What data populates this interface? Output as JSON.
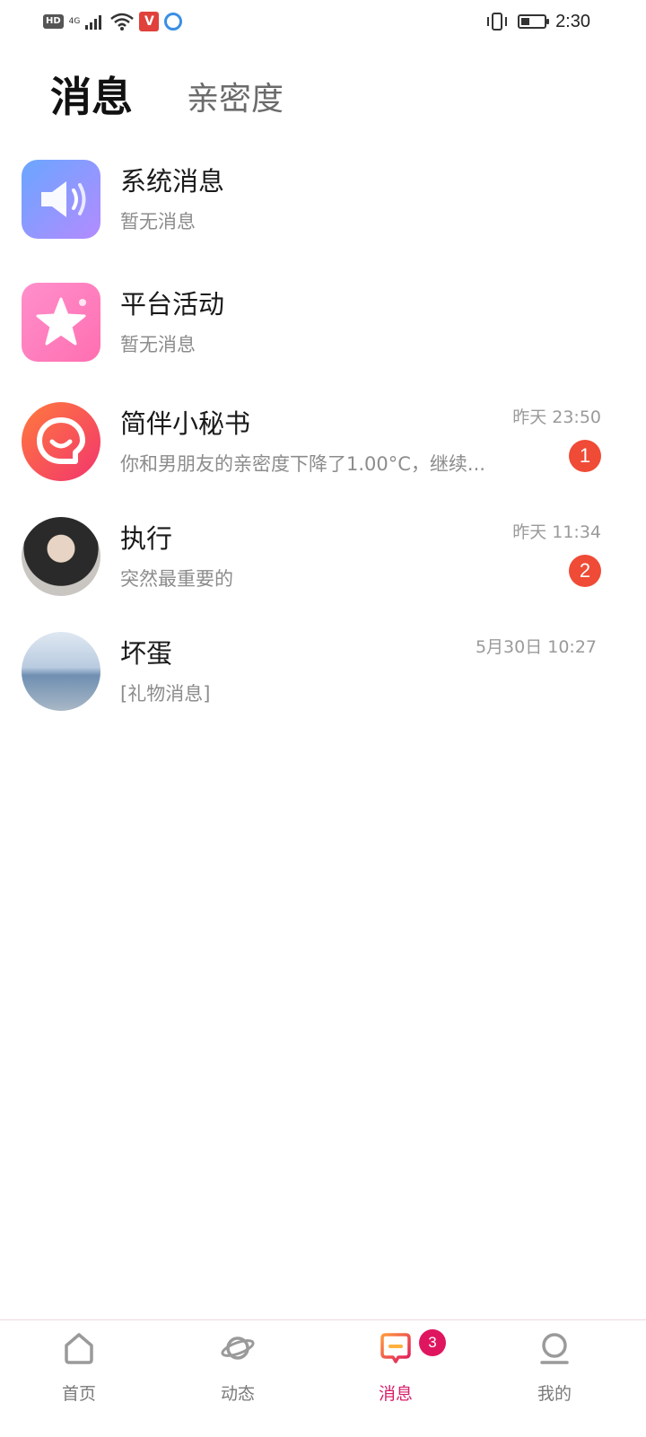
{
  "status_bar": {
    "hd": "HD",
    "network": "4G",
    "time": "2:30",
    "icons": [
      "hd-icon",
      "signal-icon",
      "wifi-icon",
      "app-notification-icon",
      "browser-icon",
      "vibrate-icon",
      "battery-icon"
    ]
  },
  "header": {
    "tabs": [
      {
        "label": "消息",
        "active": true
      },
      {
        "label": "亲密度",
        "active": false
      }
    ]
  },
  "conversations": [
    {
      "name": "系统消息",
      "preview": "暂无消息",
      "time": "",
      "unread": "",
      "avatar": "speaker-icon"
    },
    {
      "name": "平台活动",
      "preview": "暂无消息",
      "time": "",
      "unread": "",
      "avatar": "star-icon"
    },
    {
      "name": "简伴小秘书",
      "preview": "你和男朋友的亲密度下降了1.00°C，继续...",
      "time": "昨天 23:50",
      "unread": "1",
      "avatar": "chat-smile-icon"
    },
    {
      "name": "执行",
      "preview": "突然最重要的",
      "time": "昨天 11:34",
      "unread": "2",
      "avatar": "user-photo"
    },
    {
      "name": "坏蛋",
      "preview": "[礼物消息]",
      "time": "5月30日 10:27",
      "unread": "",
      "avatar": "user-photo"
    }
  ],
  "bottom_nav": {
    "items": [
      {
        "label": "首页",
        "icon": "home-icon",
        "active": false,
        "badge": ""
      },
      {
        "label": "动态",
        "icon": "planet-icon",
        "active": false,
        "badge": ""
      },
      {
        "label": "消息",
        "icon": "message-icon",
        "active": true,
        "badge": "3"
      },
      {
        "label": "我的",
        "icon": "profile-icon",
        "active": false,
        "badge": ""
      }
    ]
  },
  "colors": {
    "accent": "#d81e6a",
    "unread_badge": "#ef4b36",
    "nav_badge": "#e0155f"
  }
}
